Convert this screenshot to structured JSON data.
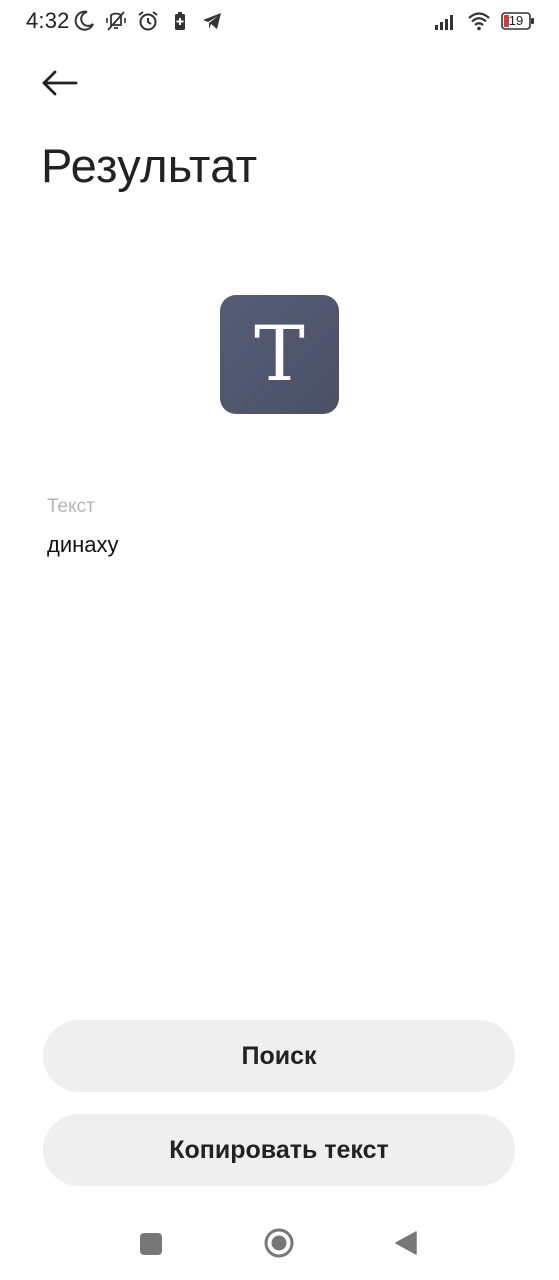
{
  "status_bar": {
    "time": "4:32",
    "battery_level": "19",
    "icons_left": [
      "moon-icon",
      "vibrate-off-icon",
      "alarm-icon",
      "battery-saver-icon",
      "telegram-icon"
    ],
    "icons_right": [
      "signal-icon",
      "wifi-icon",
      "battery-icon"
    ]
  },
  "header": {
    "title": "Результат",
    "back_icon": "arrow-left-icon"
  },
  "result": {
    "type_glyph": "T",
    "field_label": "Текст",
    "field_value": "динаху"
  },
  "actions": {
    "search_label": "Поиск",
    "copy_label": "Копировать текст"
  },
  "nav_bar": {
    "items": [
      "recents-icon",
      "home-icon",
      "back-icon"
    ]
  },
  "colors": {
    "tile": "#4f556b",
    "button_bg": "#efefef",
    "label": "#b5b5b5"
  }
}
